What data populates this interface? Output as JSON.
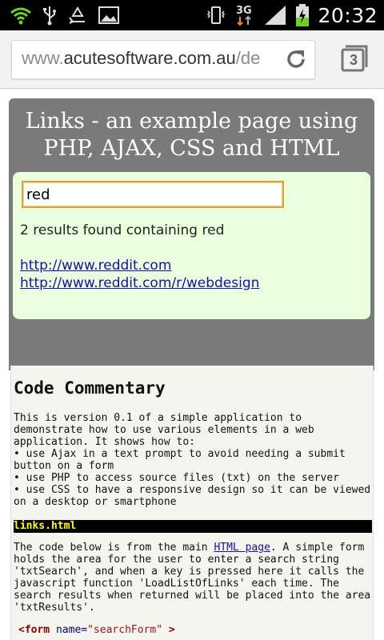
{
  "status_bar": {
    "time": "20:32",
    "network": "3G",
    "icons_left": [
      "wifi-icon",
      "usb-icon",
      "recycle-icon",
      "image-icon"
    ],
    "icons_right": [
      "vibrate-icon",
      "network-3g-icon",
      "signal-icon",
      "battery-charging-icon"
    ]
  },
  "browser": {
    "url_prefix": "www.",
    "url_host": "acutesoftware.com.au",
    "url_suffix": "/de",
    "tab_count": "3"
  },
  "page": {
    "title": "Links - an example page using PHP, AJAX, CSS and HTML",
    "search": {
      "value": "red"
    },
    "result_text": "2 results found containing red",
    "links": [
      "http://www.reddit.com ",
      "http://www.reddit.com/r/webdesign "
    ],
    "commentary": {
      "heading": "Code Commentary",
      "intro": "This is version 0.1 of a simple application to demonstrate how to use various elements in a web application. It shows how to:",
      "bullets": [
        "use Ajax in a text prompt to avoid needing a submit button on a form",
        "use PHP to access source files (txt) on the server",
        "use CSS to have a responsive design so it can be viewed on a desktop or smartphone"
      ],
      "file_name": "links.html",
      "para_before_link": "The code below is from the main ",
      "link_text": "HTML page",
      "para_after_link": ". A simple form holds the area for the user to enter a search string 'txtSearch', and when a key is pressed here it calls the javascript function 'LoadListOfLinks' each time. The search results when returned will be placed into the area 'txtResults'.",
      "code_tag": "<form",
      "code_attr": " name=",
      "code_val": "\"searchForm\"",
      "code_end": " >"
    }
  }
}
